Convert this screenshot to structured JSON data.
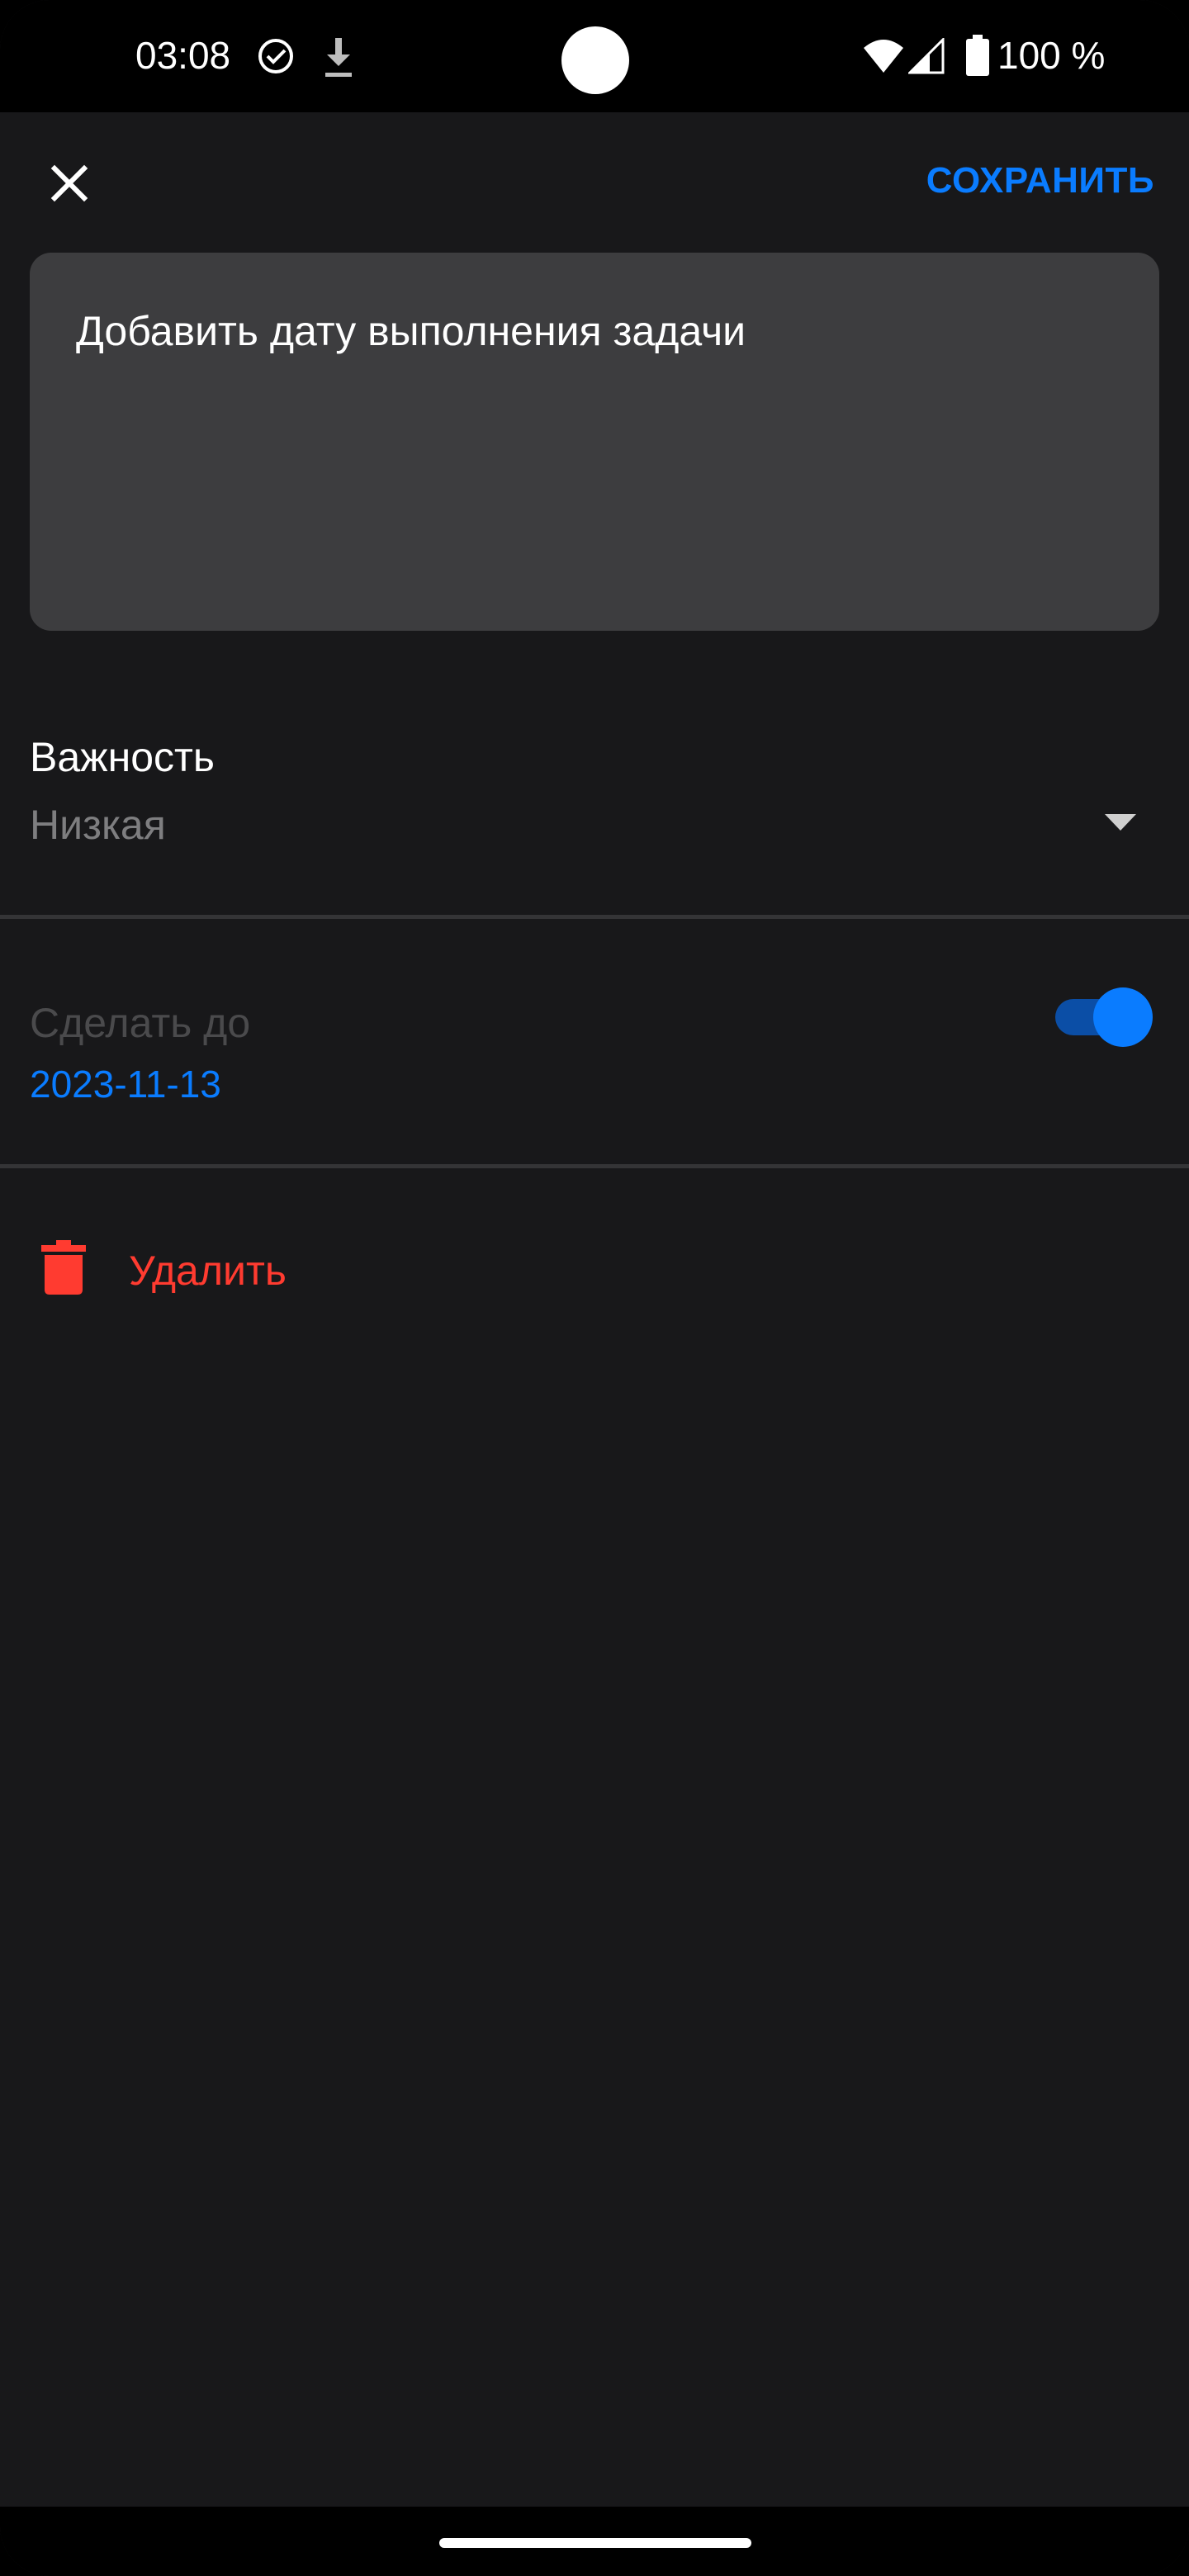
{
  "status_bar": {
    "time": "03:08",
    "battery": "100 %",
    "icons": [
      "check-circle-icon",
      "download-icon",
      "wifi-icon",
      "signal-icon",
      "battery-icon"
    ]
  },
  "toolbar": {
    "close_icon": "close-icon",
    "save_label": "СОХРАНИТЬ"
  },
  "task": {
    "text": "Добавить дату выполнения задачи"
  },
  "importance": {
    "label": "Важность",
    "value": "Низкая",
    "icon": "dropdown-arrow-icon"
  },
  "deadline": {
    "label": "Сделать до",
    "date": "2023-11-13",
    "enabled": true
  },
  "delete": {
    "label": "Удалить",
    "icon": "trash-icon"
  },
  "colors": {
    "background": "#18181a",
    "accent": "#0a7cff",
    "danger": "#ff3b30",
    "field": "#3d3d3f"
  }
}
